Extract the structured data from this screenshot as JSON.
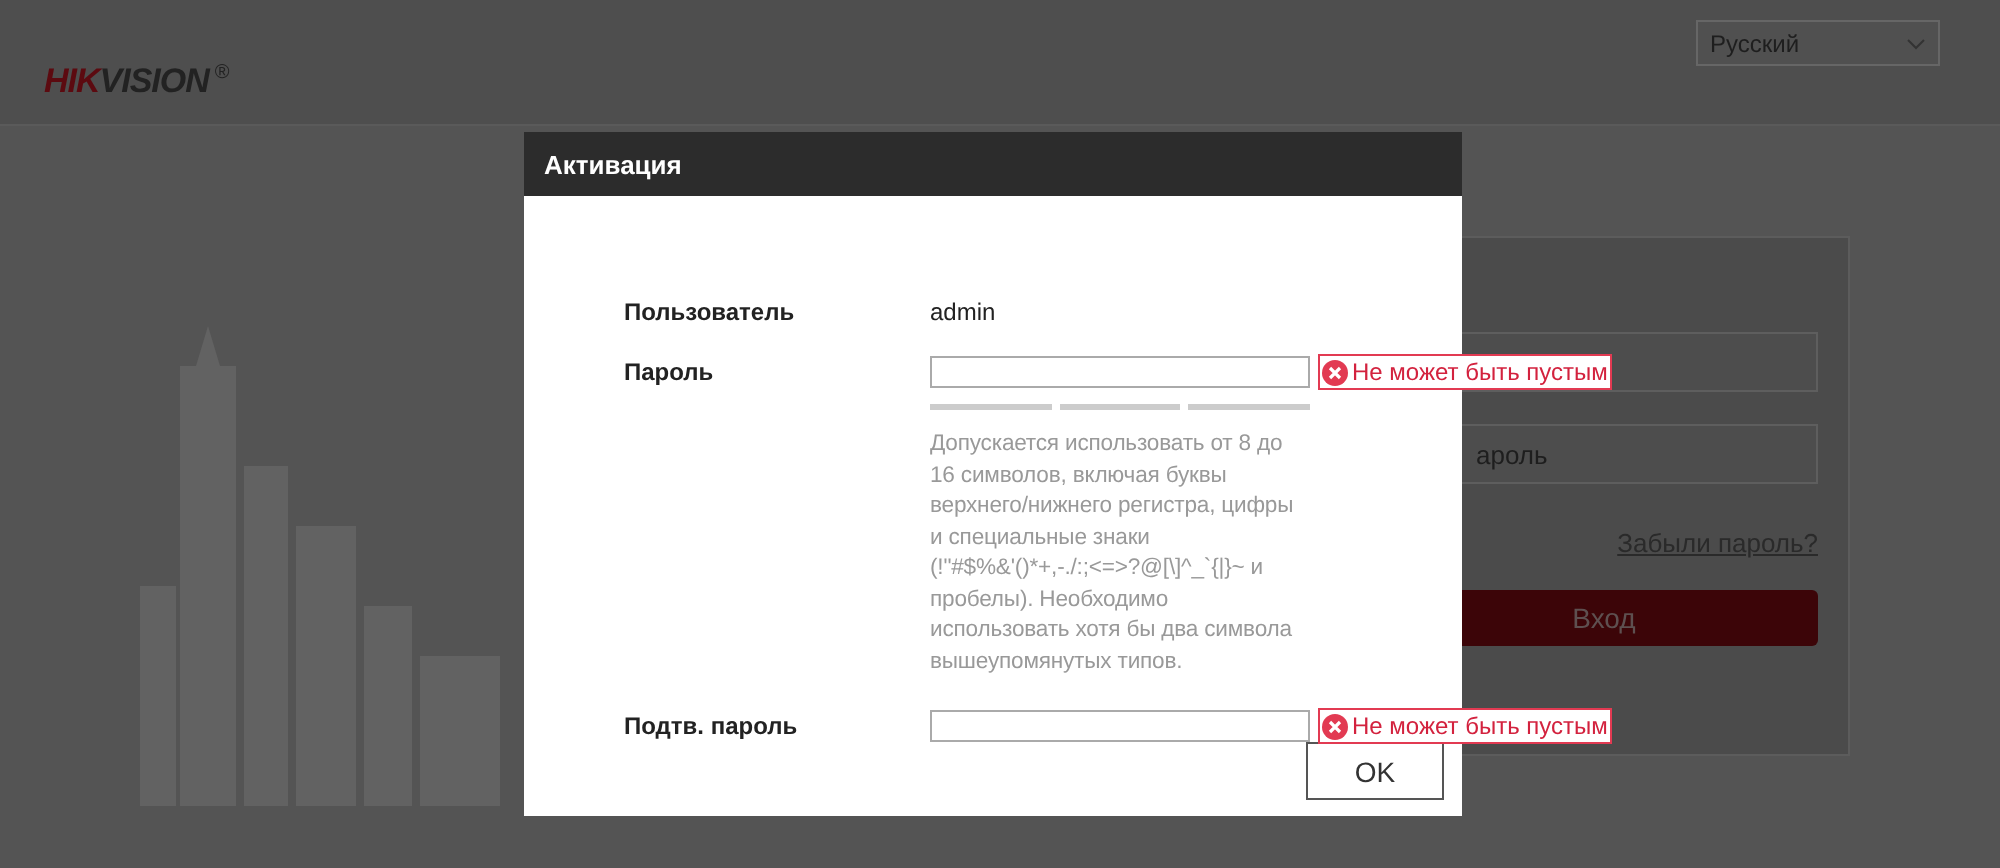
{
  "header": {
    "logo_parts": [
      {
        "text": "HIK",
        "color": "#5c0a10"
      },
      {
        "text": "VISION",
        "color": "#222222"
      }
    ],
    "logo_mark": "®",
    "language": "Русский"
  },
  "login": {
    "password_placeholder": "ароль",
    "forgot_link": "Забыли пароль?",
    "login_button": "Вход"
  },
  "dialog": {
    "title": "Активация",
    "fields": [
      {
        "kind": "text",
        "label": "Пользователь",
        "value": "admin"
      },
      {
        "kind": "password",
        "label": "Пароль",
        "error": "Не может быть пустым",
        "hint": "Допускается использовать от 8 до 16 символов, включая буквы верхнего/нижнего регистра, цифры и специальные знаки (!\"#$%&'()*+,-./:;<=>?@[\\]^_`{|}~ и пробелы). Необходимо использовать хотя бы два символа вышеупомянутых типов."
      },
      {
        "kind": "confirm",
        "label": "Подтв. пароль",
        "error": "Не может быть пустым"
      }
    ],
    "buttons": [
      "OK"
    ]
  }
}
